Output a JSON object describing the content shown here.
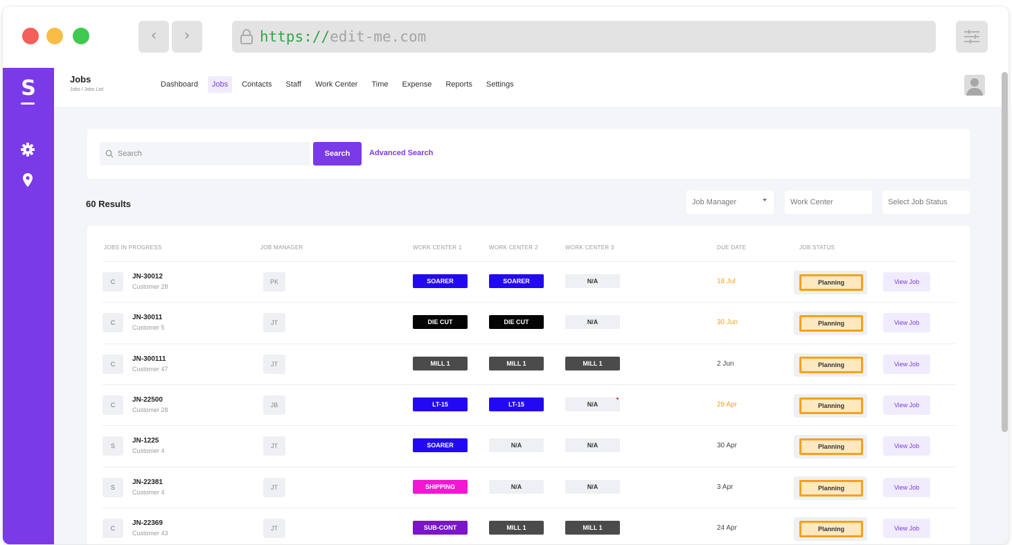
{
  "browser": {
    "url_protocol": "https://",
    "url_host": "edit-me.com",
    "back_glyph": "‹",
    "forward_glyph": "›"
  },
  "app": {
    "logo_letter": "S",
    "accent_color": "#7a3ae8",
    "page_title": "Jobs",
    "breadcrumb": "Jobs  /  Jobs List",
    "nav": [
      {
        "label": "Dashboard",
        "active": false
      },
      {
        "label": "Jobs",
        "active": true
      },
      {
        "label": "Contacts",
        "active": false
      },
      {
        "label": "Staff",
        "active": false
      },
      {
        "label": "Work Center",
        "active": false
      },
      {
        "label": "Time",
        "active": false
      },
      {
        "label": "Expense",
        "active": false
      },
      {
        "label": "Reports",
        "active": false
      },
      {
        "label": "Settings",
        "active": false
      }
    ],
    "sidebar_icons": [
      "gear-icon",
      "map-pin-icon"
    ]
  },
  "search": {
    "placeholder": "Search",
    "button_label": "Search",
    "advanced_label": "Advanced Search"
  },
  "results_label": "60 Results",
  "filters": {
    "job_manager": "Job Manager",
    "work_center": "Work Center",
    "job_status": "Select Job Status"
  },
  "table": {
    "columns": {
      "jobs": "JOBS IN PROGRESS",
      "manager": "JOB MANAGER",
      "wc1": "WORK CENTER 1",
      "wc2": "WORK CENTER 2",
      "wc3": "WORK CENTER 3",
      "due": "DUE DATE",
      "status": "JOB STATUS"
    },
    "view_label": "View Job",
    "rows": [
      {
        "type": "C",
        "id": "JN-30012",
        "customer": "Customer 28",
        "manager": "PK",
        "wc": [
          "SOARER",
          "SOARER",
          "N/A"
        ],
        "due": "18 Jul",
        "due_overdue": true,
        "status": "Planning",
        "mark": false
      },
      {
        "type": "C",
        "id": "JN-30011",
        "customer": "Customer 5",
        "manager": "JT",
        "wc": [
          "DIE CUT",
          "DIE CUT",
          "N/A"
        ],
        "due": "30 Jun",
        "due_overdue": true,
        "status": "Planning",
        "mark": false
      },
      {
        "type": "C",
        "id": "JN-300111",
        "customer": "Customer 47",
        "manager": "JT",
        "wc": [
          "MILL 1",
          "MILL 1",
          "MILL 1"
        ],
        "due": "2 Jun",
        "due_overdue": false,
        "status": "Planning",
        "mark": false
      },
      {
        "type": "C",
        "id": "JN-22500",
        "customer": "Customer 28",
        "manager": "JB",
        "wc": [
          "LT-15",
          "LT-15",
          "N/A"
        ],
        "due": "29 Apr",
        "due_overdue": true,
        "status": "Planning",
        "mark": true
      },
      {
        "type": "S",
        "id": "JN-1225",
        "customer": "Customer 4",
        "manager": "JT",
        "wc": [
          "SOARER",
          "N/A",
          "N/A"
        ],
        "due": "30 Apr",
        "due_overdue": false,
        "status": "Planning",
        "mark": false
      },
      {
        "type": "S",
        "id": "JN-22381",
        "customer": "Customer 4",
        "manager": "JT",
        "wc": [
          "SHIPPING",
          "N/A",
          "N/A"
        ],
        "due": "3 Apr",
        "due_overdue": false,
        "status": "Planning",
        "mark": false
      },
      {
        "type": "C",
        "id": "JN-22369",
        "customer": "Customer 43",
        "manager": "JT",
        "wc": [
          "SUB-CONT",
          "MILL 1",
          "MILL 1"
        ],
        "due": "24 Apr",
        "due_overdue": false,
        "status": "Planning",
        "mark": false
      }
    ]
  },
  "work_center_colors": {
    "SOARER": {
      "bg": "#2209f2",
      "fg": "#ffffff"
    },
    "DIE CUT": {
      "bg": "#050505",
      "fg": "#ffffff"
    },
    "MILL 1": {
      "bg": "#4b4b4b",
      "fg": "#ffffff"
    },
    "LT-15": {
      "bg": "#2209f2",
      "fg": "#ffffff"
    },
    "SHIPPING": {
      "bg": "#f217d2",
      "fg": "#ffffff"
    },
    "SUB-CONT": {
      "bg": "#7a15c9",
      "fg": "#ffffff"
    },
    "N/A": {
      "bg": "#eef0f3",
      "fg": "#333333"
    }
  },
  "due_colors": {
    "overdue": "#f5a11a",
    "normal": "#444444"
  }
}
